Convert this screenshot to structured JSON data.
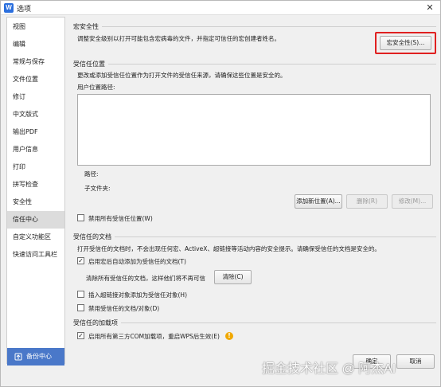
{
  "window": {
    "title": "选项",
    "app_icon_letter": "W"
  },
  "sidebar": {
    "items": [
      {
        "label": "视图"
      },
      {
        "label": "编辑"
      },
      {
        "label": "常规与保存"
      },
      {
        "label": "文件位置"
      },
      {
        "label": "修订"
      },
      {
        "label": "中文版式"
      },
      {
        "label": "输出PDF"
      },
      {
        "label": "用户信息"
      },
      {
        "label": "打印"
      },
      {
        "label": "拼写检查"
      },
      {
        "label": "安全性"
      },
      {
        "label": "信任中心",
        "active": true
      },
      {
        "label": "自定义功能区"
      },
      {
        "label": "快速访问工具栏"
      }
    ],
    "backup_label": "备份中心"
  },
  "macro_security": {
    "title": "宏安全性",
    "description": "调整安全级别以打开可能包含宏病毒的文件，并指定可信任的宏创建者姓名。",
    "button_label": "宏安全性(S)..."
  },
  "trusted_locations": {
    "title": "受信任位置",
    "description": "更改或添加受信任位置作为打开文件的受信任来源，请确保这些位置是安全的。",
    "user_paths_label": "用户位置路径:",
    "path_label": "路径:",
    "subfolder_label": "子文件夹:",
    "add_button": "添加新位置(A)...",
    "delete_button": "删除(R)",
    "modify_button": "修改(M)...",
    "disable_all_label": "禁用所有受信任位置(W)",
    "disable_all_checked": false
  },
  "trusted_documents": {
    "title": "受信任的文档",
    "description": "打开受信任的文档时，不会出现任何宏、ActiveX、超链接等活动内容的安全提示。请确保受信任的文档是安全的。",
    "auto_add_label": "启用宏后自动添加为受信任的文档(T)",
    "auto_add_checked": true,
    "clear_text": "清除所有受信任的文档，这样他们将不再可信",
    "clear_button": "清除(C)",
    "hyperlink_label": "插入超链接对象添加为受信任对象(H)",
    "hyperlink_checked": false,
    "disable_docs_label": "禁用受信任的文档/对象(D)",
    "disable_docs_checked": false
  },
  "trusted_addins": {
    "title": "受信任的加载项",
    "enable_label": "启用所有第三方COM加载项，重启WPS后生效(E)",
    "enable_checked": true
  },
  "footer": {
    "ok_label": "确定",
    "cancel_label": "取消"
  },
  "watermark": "掘金技术社区 @ 阿杰AI",
  "colors": {
    "highlight_border": "#e02020",
    "backup_bg": "#4a78c9",
    "active_item_bg": "#dcdcdc",
    "warn_icon": "#f0a800"
  }
}
